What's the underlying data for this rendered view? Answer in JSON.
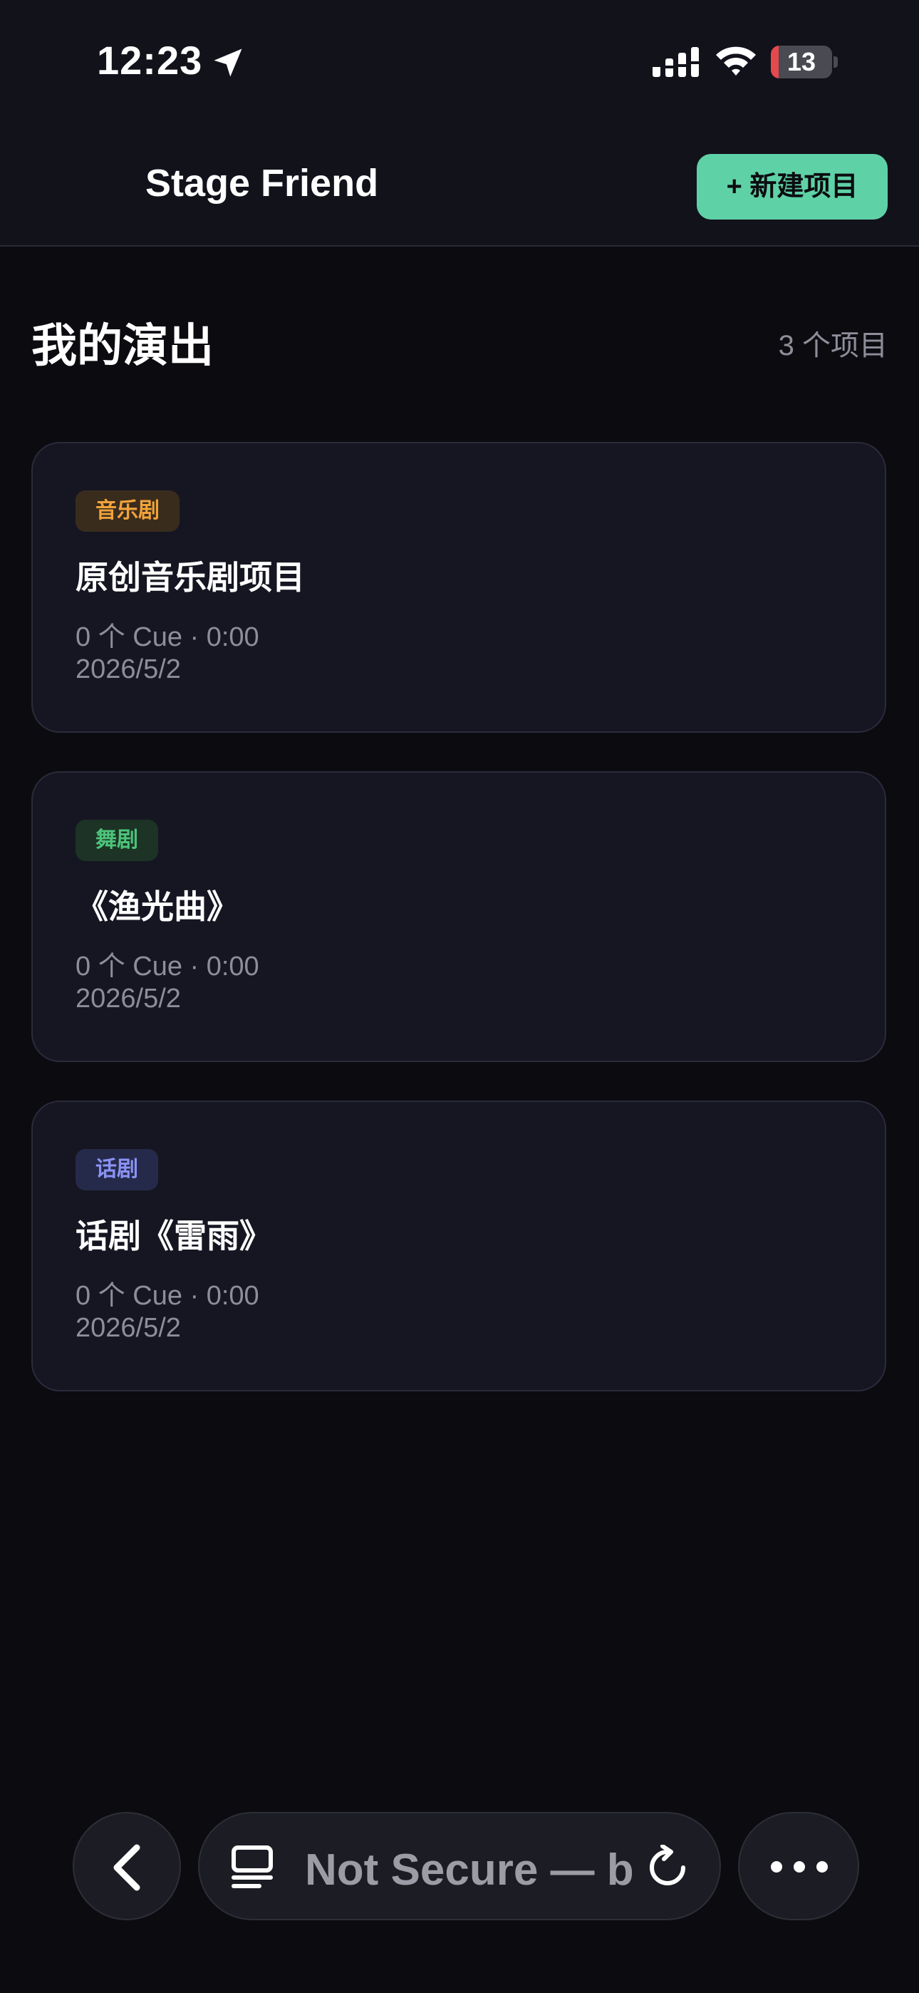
{
  "status_bar": {
    "time": "12:23",
    "battery_level": "13",
    "battery_fraction": 0.13,
    "icons": [
      "location-arrow-icon",
      "cellular-signal-icon",
      "wifi-icon",
      "battery-icon"
    ]
  },
  "header": {
    "title": "Stage Friend",
    "new_project_label": "+ 新建项目"
  },
  "main": {
    "title": "我的演出",
    "count": "3 个项目",
    "projects": [
      {
        "tag": "音乐剧",
        "title": "原创音乐剧项目",
        "meta": "0 个 Cue · 0:00",
        "date": "2026/5/2"
      },
      {
        "tag": "舞剧",
        "title": "《渔光曲》",
        "meta": "0 个 Cue · 0:00",
        "date": "2026/5/2"
      },
      {
        "tag": "话剧",
        "title": "话剧《雷雨》",
        "meta": "0 个 Cue · 0:00",
        "date": "2026/5/2"
      }
    ]
  },
  "browser_bar": {
    "address": "Not Secure — b",
    "icons": [
      "chevron-left-icon",
      "reader-mode-icon",
      "reload-icon",
      "more-dots-icon"
    ]
  },
  "colors": {
    "accent": "#5fd1a6",
    "background": "#0b0b10",
    "card": "#161622",
    "tag_musical": "#f2a33a",
    "tag_dance": "#4cc47a",
    "tag_drama": "#8a93f5"
  }
}
